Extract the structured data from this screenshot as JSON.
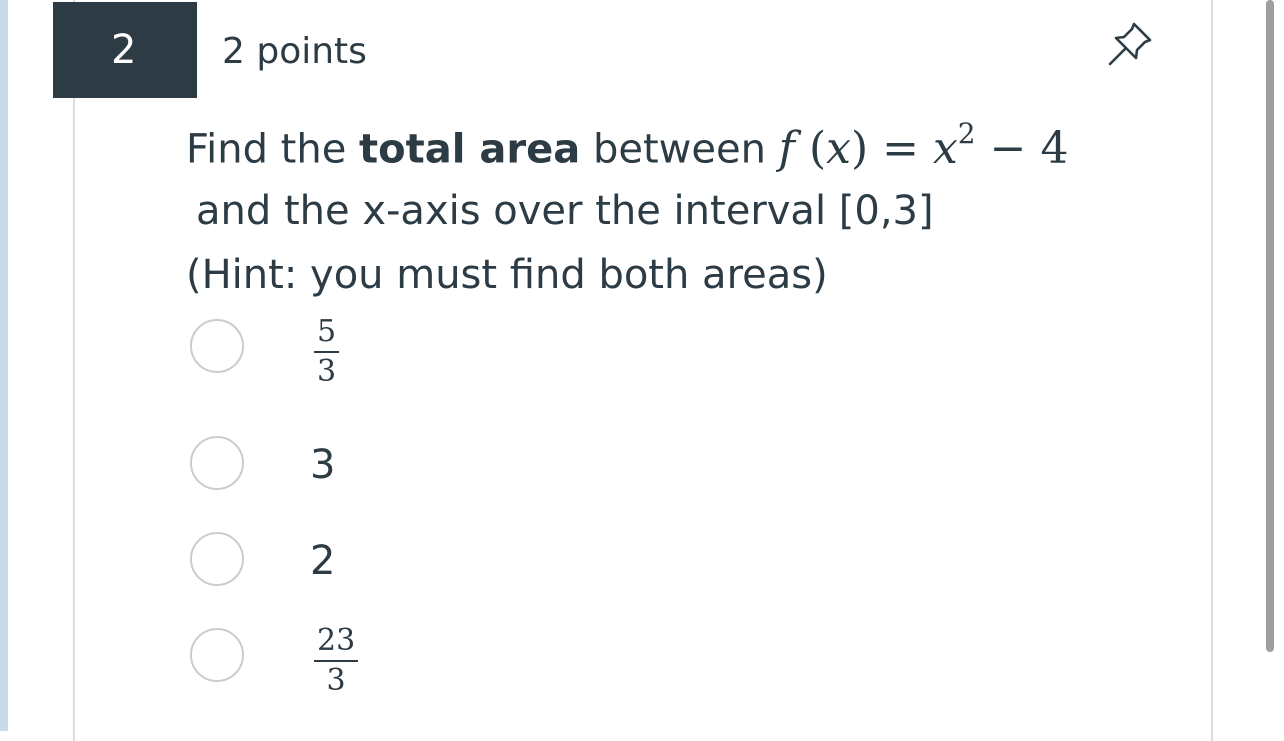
{
  "question": {
    "number": "2",
    "points": "2 points",
    "text_prefix": "Find the ",
    "text_bold": "total area",
    "text_middle": " between ",
    "formula": {
      "f": "f",
      "open": "(",
      "x": "x",
      "close": ")",
      "eq": " = ",
      "base": "x",
      "exp": "2",
      "rest": " − 4"
    },
    "line2": "and the x-axis over the interval [0,3]",
    "line3": "(Hint: you must find both areas)"
  },
  "options": [
    {
      "numerator": "5",
      "denominator": "3"
    },
    {
      "label": "3"
    },
    {
      "label": "2"
    },
    {
      "numerator": "23",
      "denominator": "3"
    }
  ],
  "icons": {
    "pin": "pin-icon"
  },
  "colors": {
    "number_badge_bg": "#2d3b45",
    "text": "#2d3b45",
    "radio_border": "#c7cdd1"
  }
}
